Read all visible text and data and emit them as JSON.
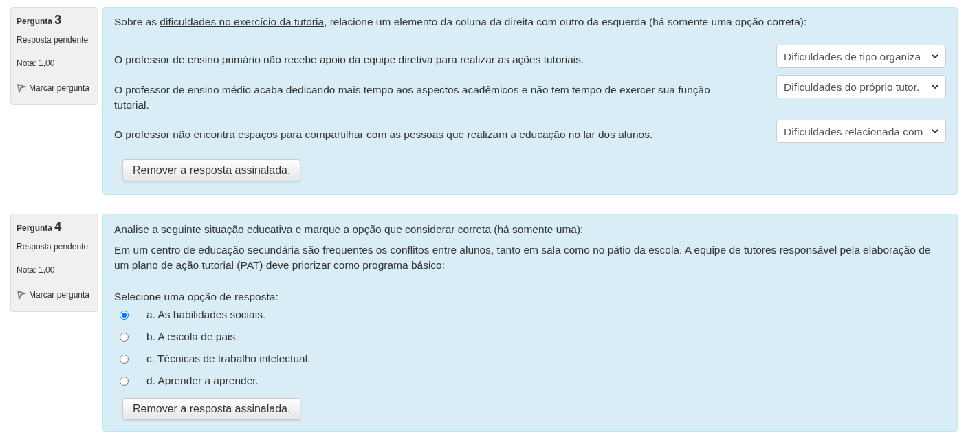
{
  "questions": [
    {
      "kind": "match",
      "label": "Pergunta",
      "number": "3",
      "state": "Resposta pendente",
      "grade": "Nota: 1,00",
      "flag": "Marcar pergunta",
      "prompt_before": "Sobre as",
      "prompt_link": "dificuldades no exercício da tutoria",
      "prompt_after": ", relacione um elemento da coluna da direita com outro da esquerda (há somente uma opção correta):",
      "pairs": [
        {
          "text": "O professor de ensino primário não recebe apoio da equipe diretiva para realizar as ações tutoriais.",
          "choice": "Dificuldades de tipo organiza"
        },
        {
          "text": "O professor de ensino médio acaba dedicando mais tempo aos aspectos acadêmicos e não tem tempo de exercer sua função tutorial.",
          "choice": "Dificuldades do próprio tutor."
        },
        {
          "text": "O professor não encontra espaços para compartilhar com as pessoas que realizam a educação no lar dos alunos.",
          "choice": "Dificuldades relacionada com"
        }
      ],
      "clear_button": "Remover a resposta assinalada."
    },
    {
      "kind": "multichoice",
      "label": "Pergunta",
      "number": "4",
      "state": "Resposta pendente",
      "grade": "Nota: 1,00",
      "flag": "Marcar pergunta",
      "intro": "Analise a seguinte situação educativa e marque a opção que considerar correta (há somente uma):",
      "situation": "Em um centro de educação secundária são frequentes os conflitos entre alunos, tanto em sala como no pátio da escola. A equipe de tutores responsável pela elaboração de um plano de ação tutorial (PAT) deve priorizar como programa básico:",
      "select_prompt": "Selecione uma opção de resposta:",
      "options": [
        {
          "text": "a. As habilidades sociais.",
          "selected": true
        },
        {
          "text": "b. A escola de pais.",
          "selected": false
        },
        {
          "text": "c. Técnicas de trabalho intelectual.",
          "selected": false
        },
        {
          "text": "d. Aprender a aprender.",
          "selected": false
        }
      ],
      "clear_button": "Remover a resposta assinalada."
    }
  ]
}
